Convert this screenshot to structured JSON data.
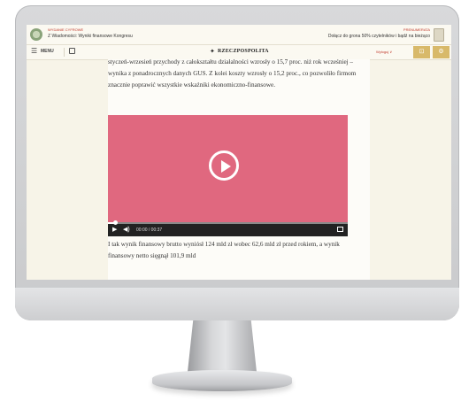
{
  "topbar": {
    "left_line1": "WYDANIE CYFROWE",
    "left_line2": "Z Wiadomości: Wyniki finansowe Kongresu",
    "right_line1": "PRENUMERATA",
    "right_line2": "Dołącz do grona 50% czytelników i bądź na bieżąco"
  },
  "navbar": {
    "menu_label": "MENU",
    "brand_name": "RZECZPOSPOLITA",
    "right_label": "Wyloguj ∨"
  },
  "article": {
    "para_top": "styczeń-wrzesień przychody z całokształtu działalności wzrosły o 15,7 proc. niż rok wcześniej – wynika z ponadrocznych danych GUS. Z kolei koszty wzrosły o 15,2 proc., co pozwoliło firmom znacznie poprawić wszystkie wskaźniki ekonomiczno-finansowe.",
    "para_bottom": "I tak wynik finansowy brutto wyniósł 124 mld zł wobec 62,6 mld zł przed rokiem, a wynik finansowy netto sięgnął 101,9 mld"
  },
  "video": {
    "time": "00:00 / 00:37",
    "progress": 0.03,
    "play_icon": "play-circle-icon",
    "bg_color": "#e0687f"
  },
  "colors": {
    "accent": "#d8b96a",
    "link_red": "#c0392b",
    "page_bg": "#f7f4e8"
  }
}
